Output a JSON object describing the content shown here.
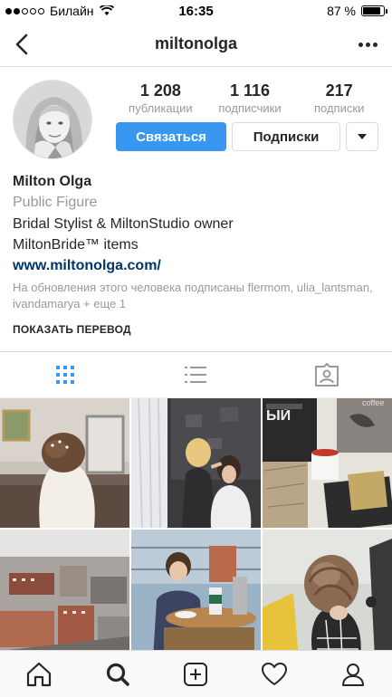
{
  "status_bar": {
    "carrier": "Билайн",
    "time": "16:35",
    "battery": "87 %",
    "battery_level": 0.87,
    "signal_bars": 2
  },
  "nav": {
    "username": "miltonolga"
  },
  "stats": [
    {
      "value": "1 208",
      "label": "публикации"
    },
    {
      "value": "1 116",
      "label": "подписчики"
    },
    {
      "value": "217",
      "label": "подписки"
    }
  ],
  "actions": {
    "contact_label": "Связаться",
    "following_label": "Подписки"
  },
  "bio": {
    "name": "Milton Olga",
    "category": "Public Figure",
    "line1": "Bridal Stylist & MiltonStudio owner",
    "line2": "MiltonBride™ items",
    "link": "www.miltonolga.com/",
    "followed_by": "На обновления этого человека подписаны flermom, ulia_lantsman, ivandamarya + еще 1",
    "translate": "ПОКАЗАТЬ ПЕРЕВОД"
  },
  "tabs": [
    "grid-icon",
    "list-icon",
    "tagged-icon"
  ],
  "colors": {
    "accent": "#3897f0",
    "link": "#003569",
    "muted": "#999999",
    "border": "#dbdbdb"
  },
  "bottom_nav": [
    "home-icon",
    "search-icon",
    "add-post-icon",
    "heart-icon",
    "profile-icon"
  ]
}
